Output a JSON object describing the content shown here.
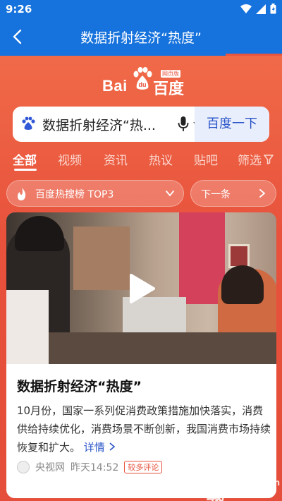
{
  "status_bar": {
    "time": "9:26"
  },
  "app_bar": {
    "title": "数据折射经济“热度”"
  },
  "logo": {
    "word": "Bai",
    "paw_text": "du",
    "brand": "百度",
    "tag": "网页版"
  },
  "search": {
    "query": "数据折射经济“热...",
    "button_label": "百度一下"
  },
  "tabs": [
    {
      "label": "全部",
      "active": true
    },
    {
      "label": "视频",
      "active": false
    },
    {
      "label": "资讯",
      "active": false
    },
    {
      "label": "热议",
      "active": false
    },
    {
      "label": "贴吧",
      "active": false
    }
  ],
  "filter_label": "筛选",
  "hot_list": {
    "label": "百度热搜榜 TOP3"
  },
  "next_label": "下一条",
  "card": {
    "headline": "数据折射经济“热度”",
    "body": "10月份，国家一系列促消费政策措施加快落实，消费供给持续优化，消费场景不断创新，我国消费市场持续恢复和扩大。",
    "more_label": "详情 ",
    "source": "央视网",
    "time": "昨天14:52",
    "badge": "较多评论"
  },
  "watermark": {
    "title": "飞翔下载",
    "url": "www.fxxz.com"
  },
  "colors": {
    "brand_blue": "#1672dc",
    "baidu_red": "#e8523c",
    "link_blue": "#2a56c8"
  }
}
